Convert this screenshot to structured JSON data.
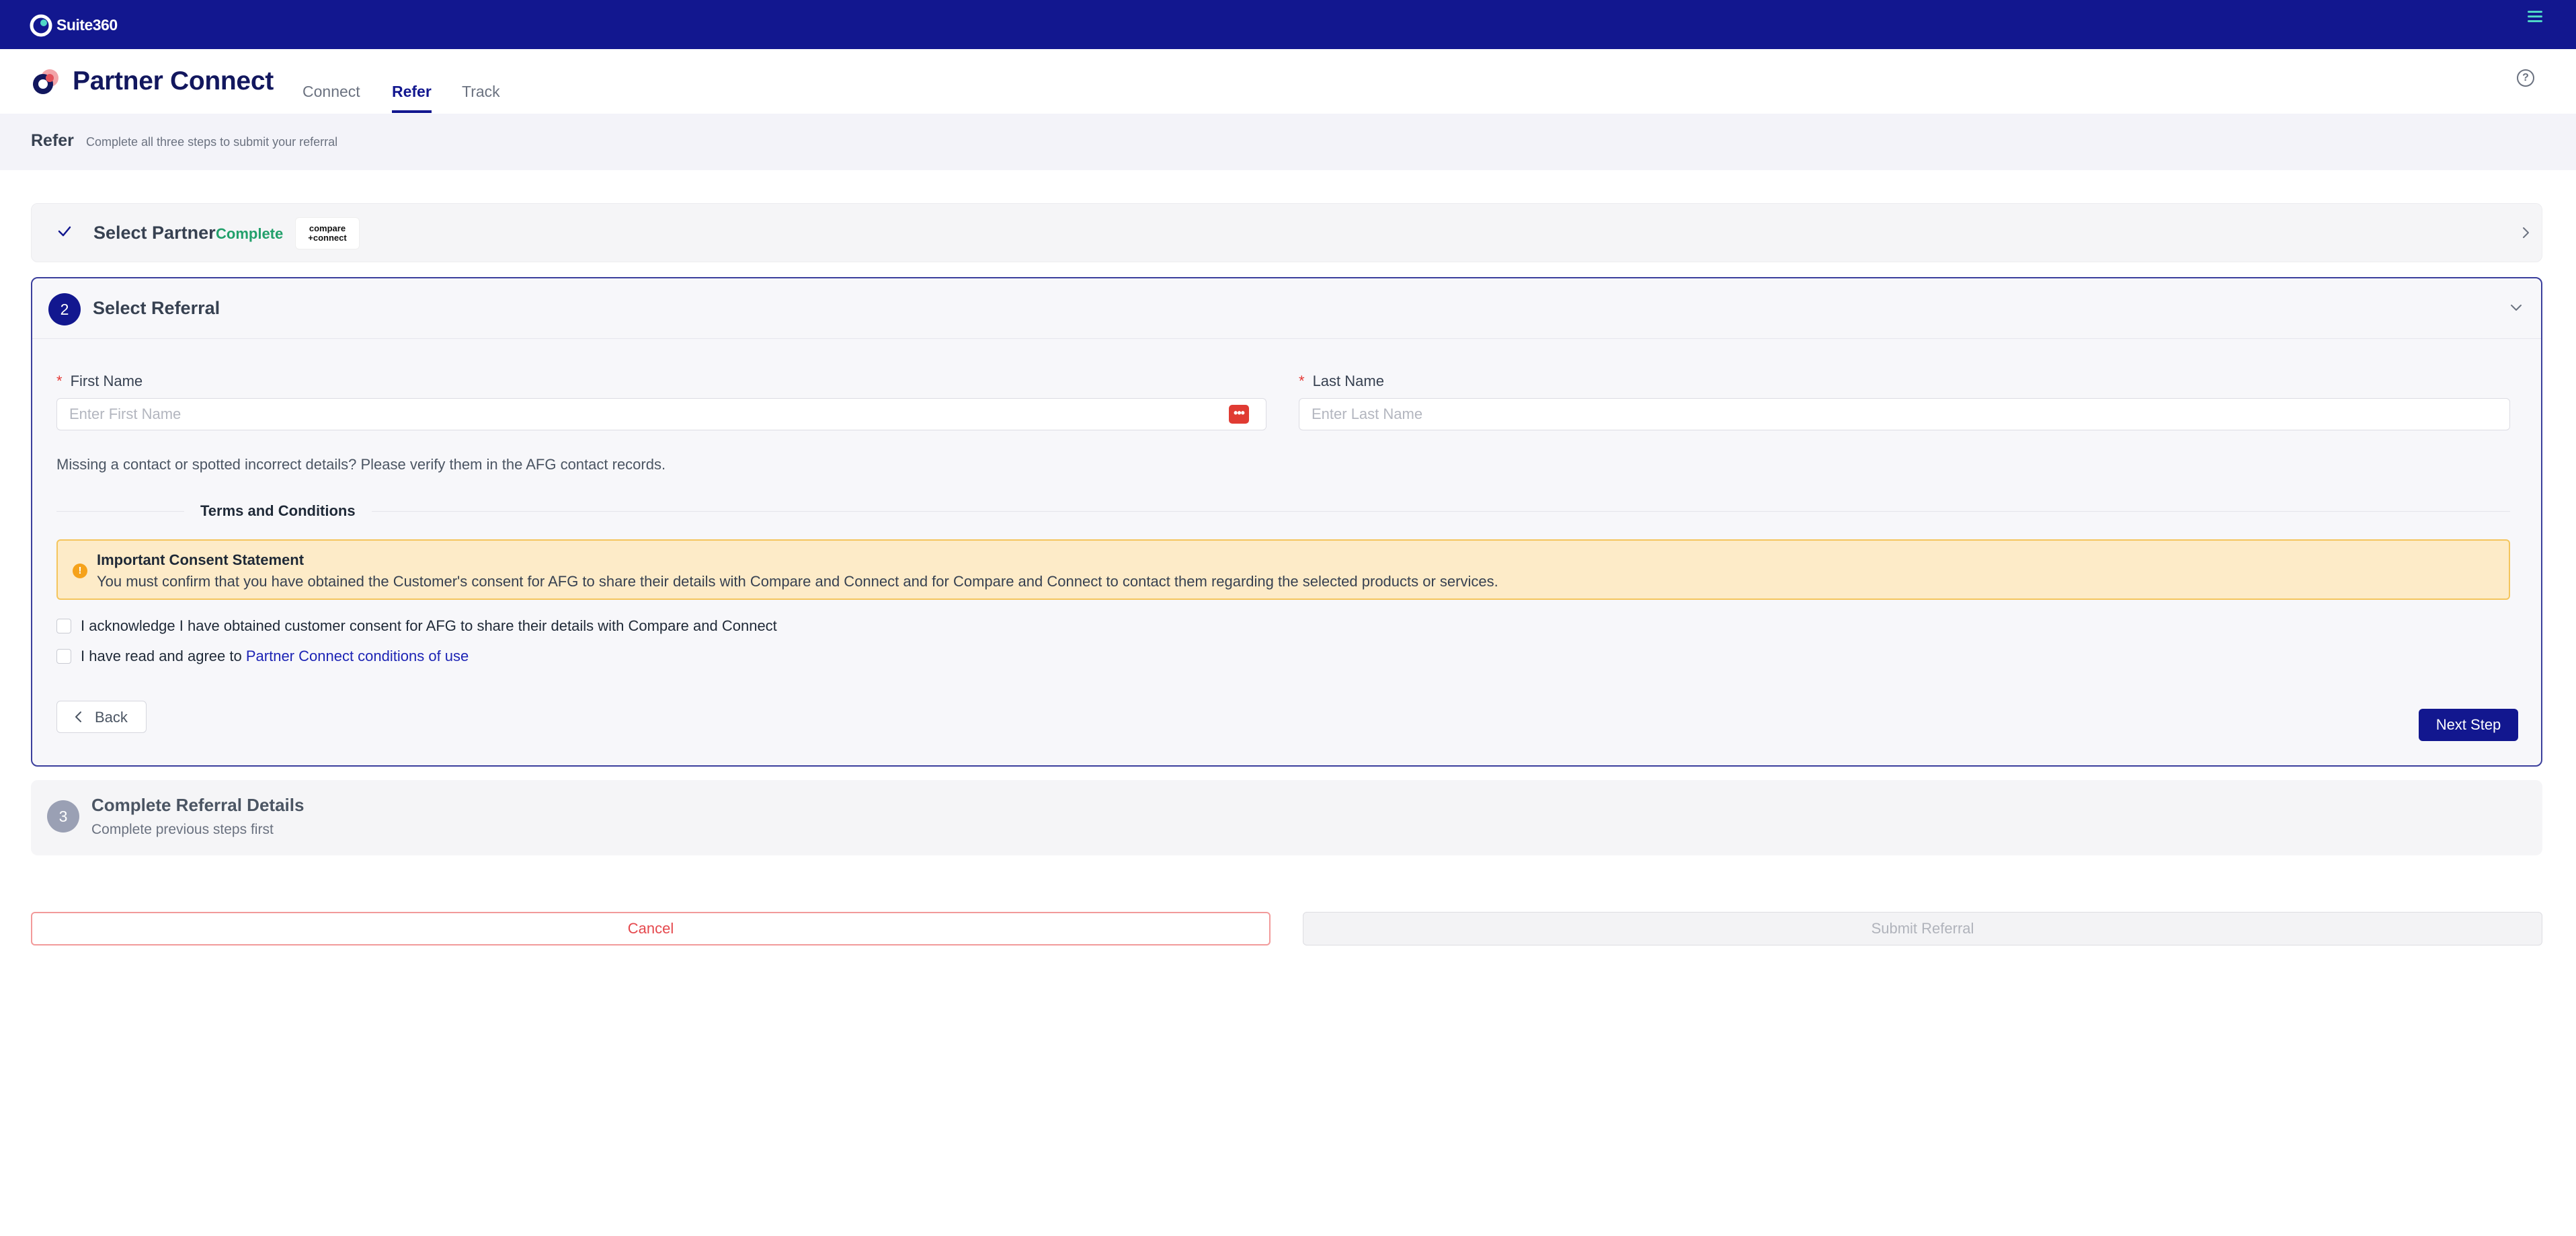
{
  "suite": {
    "name": "Suite360"
  },
  "app": {
    "title": "Partner Connect",
    "tabs": [
      {
        "label": "Connect",
        "active": false
      },
      {
        "label": "Refer",
        "active": true
      },
      {
        "label": "Track",
        "active": false
      }
    ],
    "help_icon": "?"
  },
  "page": {
    "title": "Refer",
    "description": "Complete all three steps to submit your referral"
  },
  "step1": {
    "title": "Select Partner",
    "status": "Complete",
    "partner_logo_line1": "compare",
    "partner_logo_line2": "+connect"
  },
  "step2": {
    "number": "2",
    "title": "Select Referral",
    "first_name": {
      "label": "First Name",
      "placeholder": "Enter First Name",
      "value": ""
    },
    "last_name": {
      "label": "Last Name",
      "placeholder": "Enter Last Name",
      "value": ""
    },
    "required_mark": "*",
    "missing_note": "Missing a contact or spotted incorrect details? Please verify them in the AFG contact records.",
    "terms_heading": "Terms and Conditions",
    "alert": {
      "icon": "!",
      "title": "Important Consent Statement",
      "body": "You must confirm that you have obtained the Customer's consent for AFG to share their details with Compare and Connect and for Compare and Connect to contact them regarding the selected products or services."
    },
    "checkbox1": {
      "label": "I acknowledge I have obtained customer consent for AFG to share their details with Compare and Connect",
      "checked": false
    },
    "checkbox2": {
      "label_prefix": "I have read and agree to ",
      "link": "Partner Connect conditions of use",
      "checked": false
    },
    "back_label": "Back",
    "next_label": "Next Step"
  },
  "step3": {
    "number": "3",
    "title": "Complete Referral Details",
    "subtitle": "Complete previous steps first"
  },
  "footer": {
    "cancel_label": "Cancel",
    "submit_label": "Submit Referral"
  },
  "colors": {
    "topbar": "#12178f",
    "accent": "#12178f",
    "success": "#22a06b",
    "danger": "#e5484d",
    "warning_bg": "#fdebc8",
    "warning_border": "#f4c55d"
  },
  "icons": {
    "suite_logo": "suite360-logo-icon",
    "menu": "hamburger-menu-icon",
    "partner_logo": "partner-connect-logo-icon",
    "help": "help-circle-icon",
    "check": "check-icon",
    "chevron_right": "chevron-right-icon",
    "chevron_down": "chevron-down-icon",
    "password_manager": "password-manager-icon",
    "warning": "warning-circle-icon",
    "back": "chevron-left-icon"
  }
}
